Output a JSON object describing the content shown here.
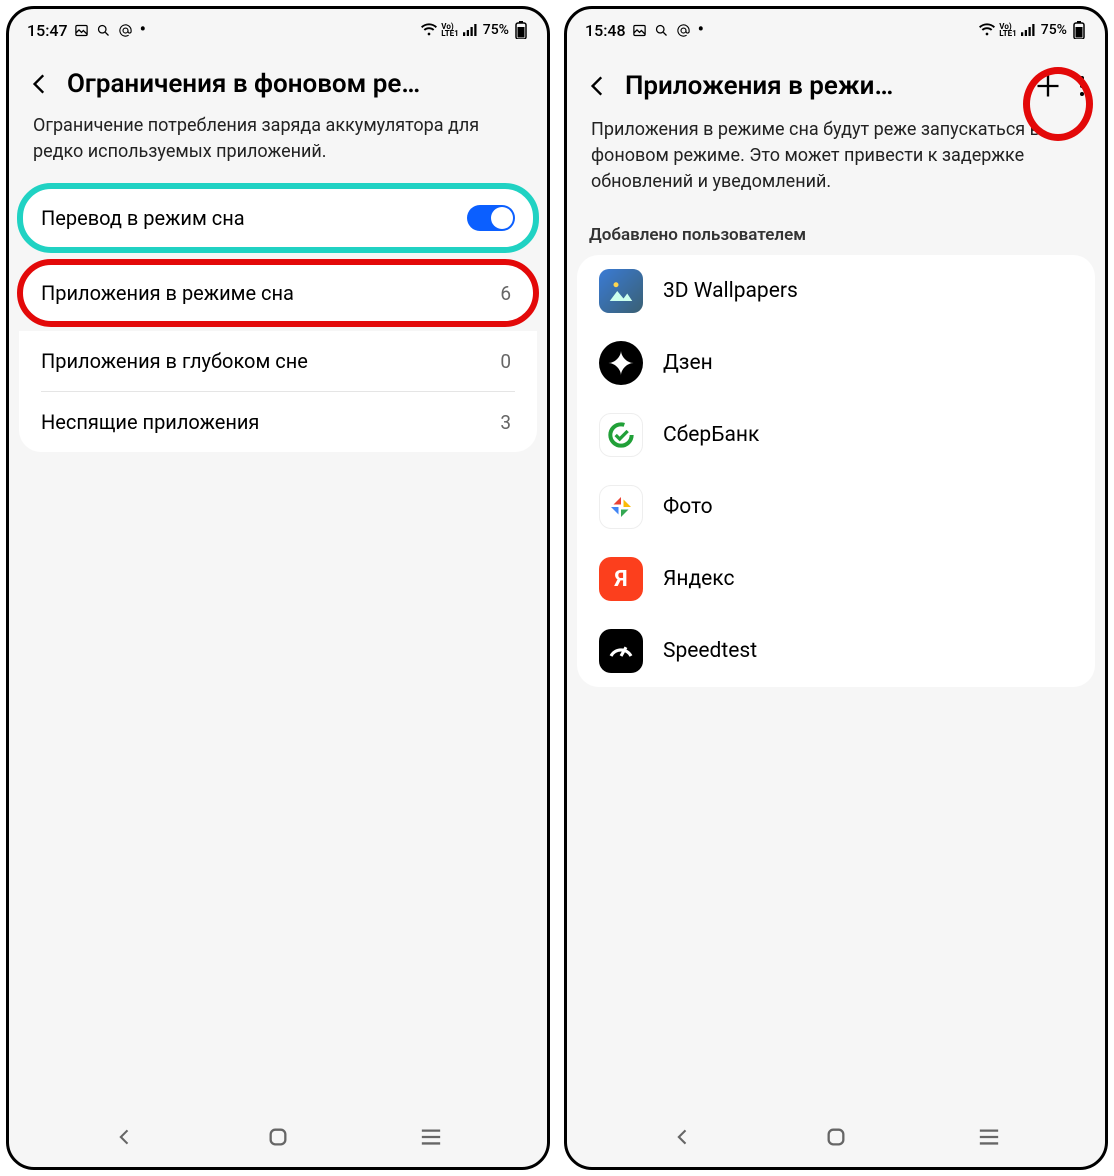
{
  "screen1": {
    "status": {
      "time": "15:47",
      "battery": "75%"
    },
    "title": "Ограничения в фоновом ре…",
    "desc": "Ограничение потребления заряда аккумулятора для редко используемых приложений.",
    "sleep_toggle_label": "Перевод в режим сна",
    "rows": [
      {
        "label": "Приложения в режиме сна",
        "count": "6"
      },
      {
        "label": "Приложения в глубоком сне",
        "count": "0"
      },
      {
        "label": "Неспящие приложения",
        "count": "3"
      }
    ]
  },
  "screen2": {
    "status": {
      "time": "15:48",
      "battery": "75%"
    },
    "title": "Приложения в режи…",
    "desc": "Приложения в режиме сна будут реже запускаться в фоновом режиме. Это может привести к задержке обновлений и уведомлений.",
    "section": "Добавлено пользователем",
    "apps": [
      {
        "name": "3D Wallpapers",
        "icon": "wallpapers"
      },
      {
        "name": "Дзен",
        "icon": "dzen"
      },
      {
        "name": "СберБанк",
        "icon": "sber"
      },
      {
        "name": "Фото",
        "icon": "photos"
      },
      {
        "name": "Яндекс",
        "icon": "yandex"
      },
      {
        "name": "Speedtest",
        "icon": "speedtest"
      }
    ]
  }
}
